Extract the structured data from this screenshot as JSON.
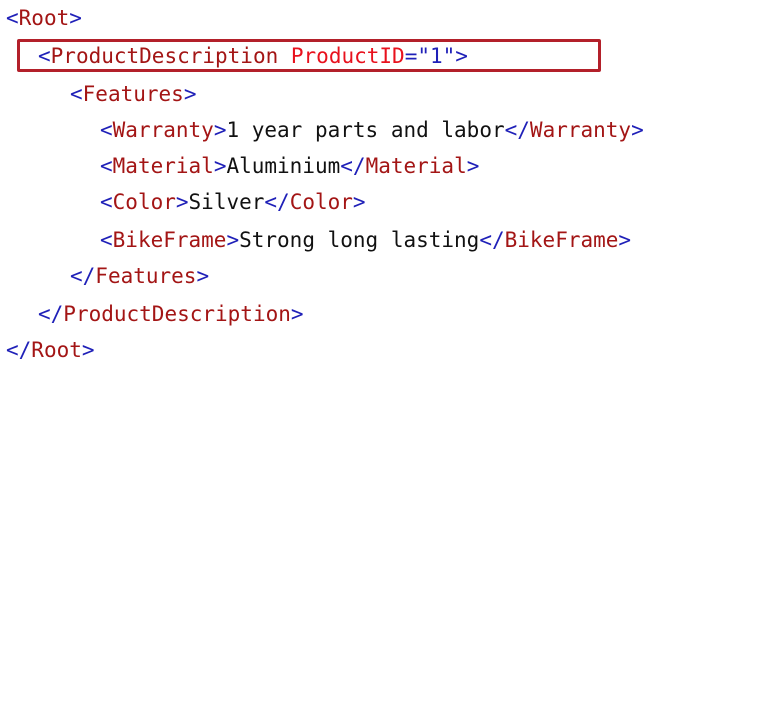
{
  "xml": {
    "root_open": {
      "lt": "<",
      "name": "Root",
      "gt": ">"
    },
    "product_open": {
      "lt": "<",
      "name": "ProductDescription",
      "attr_name": "ProductID",
      "eq": "=",
      "attr_value": "\"1\"",
      "gt": ">"
    },
    "features_open": {
      "lt": "<",
      "name": "Features",
      "gt": ">"
    },
    "warranty": {
      "lt": "<",
      "name": "Warranty",
      "gt": ">",
      "text": "1 year parts and labor",
      "close_lt": "</",
      "close_name": "Warranty",
      "close_gt": ">"
    },
    "material": {
      "lt": "<",
      "name": "Material",
      "gt": ">",
      "text": "Aluminium",
      "close_lt": "</",
      "close_name": "Material",
      "close_gt": ">"
    },
    "color": {
      "lt": "<",
      "name": "Color",
      "gt": ">",
      "text": "Silver",
      "close_lt": "</",
      "close_name": "Color",
      "close_gt": ">"
    },
    "bikeframe": {
      "lt": "<",
      "name": "BikeFrame",
      "gt": ">",
      "text": "Strong long lasting",
      "close_lt": "</",
      "close_name": "BikeFrame",
      "close_gt": ">"
    },
    "features_close": {
      "lt": "</",
      "name": "Features",
      "gt": ">"
    },
    "product_close": {
      "lt": "</",
      "name": "ProductDescription",
      "gt": ">"
    },
    "root_close": {
      "lt": "</",
      "name": "Root",
      "gt": ">"
    }
  },
  "colors": {
    "bracket": "#1f20b8",
    "tag_name": "#a31515",
    "attribute_name": "#e8111d",
    "text": "#111111",
    "highlight_border": "#b3202a"
  }
}
